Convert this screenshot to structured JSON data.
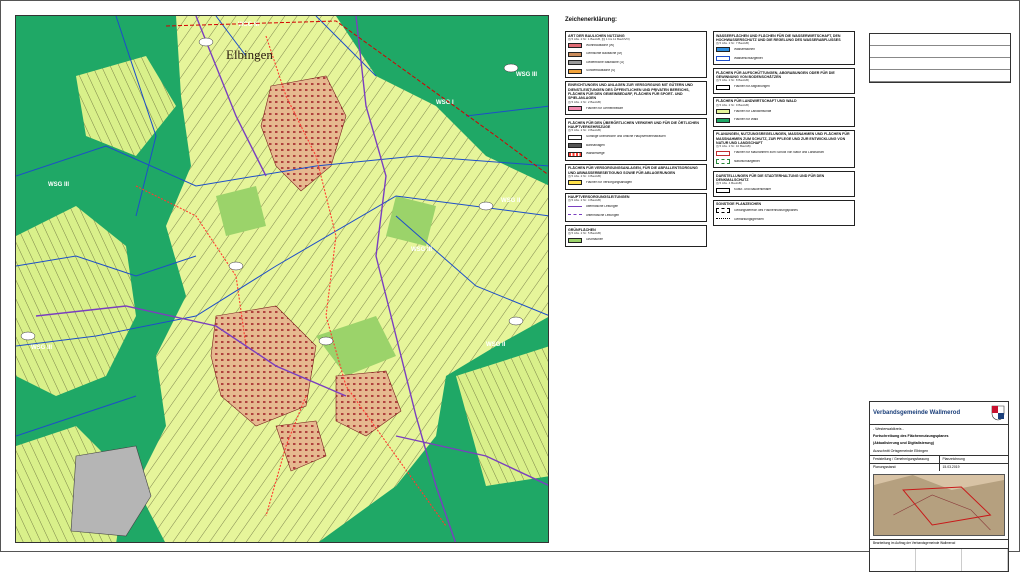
{
  "legend": {
    "heading": "Zeichenerklärung:",
    "column_a": [
      {
        "title": "ART DER BAULICHEN NUTZUNG",
        "ref": "(§ 5 Abs. 2 Nr. 1 BauGB, §§ 1 bis 11 BauNVO)",
        "rows": [
          {
            "label": "Wohnbaufläche (W)",
            "color": "#e06c75"
          },
          {
            "label": "Gemischte Baufläche (M)",
            "color": "#c98b5a"
          },
          {
            "label": "Gewerbliche Baufläche (G)",
            "color": "#9a9a9a"
          },
          {
            "label": "Sonderbaufläche (S)",
            "color": "#f2a23a"
          }
        ]
      },
      {
        "title": "EINRICHTUNGEN UND ANLAGEN ZUR VERSORGUNG MIT GÜTERN UND DIENSTLEISTUNGEN DES ÖFFENTLICHEN UND PRIVATEN BEREICHS, FLÄCHEN FÜR DEN GEMEINBEDARF, FLÄCHEN FÜR SPORT- UND SPIELANLAGEN",
        "ref": "(§ 5 Abs. 2 Nr. 2 BauGB)",
        "rows": [
          {
            "label": "Flächen für Gemeinbedarf",
            "color": "#f28bb0"
          }
        ]
      },
      {
        "title": "FLÄCHEN FÜR DEN ÜBERÖRTLICHEN VERKEHR UND FÜR DIE ÖRTLICHEN HAUPTVERKEHRSZÜGE",
        "ref": "(§ 5 Abs. 2 Nr. 3 BauGB)",
        "rows": [
          {
            "label": "Sonstige überörtliche und örtliche Hauptverkehrsstraßen",
            "color": "#ffffff"
          },
          {
            "label": "Bahnanlagen",
            "color": "#555555"
          },
          {
            "label": "Wanderwege",
            "color": "#ff3b30"
          }
        ]
      },
      {
        "title": "FLÄCHEN FÜR VERSORGUNGSANLAGEN, FÜR DIE ABFALLENTSORGUNG UND ABWASSERBESEITIGUNG SOWIE FÜR ABLAGERUNGEN",
        "ref": "(§ 5 Abs. 2 Nr. 4 BauGB)",
        "rows": [
          {
            "label": "Flächen für Versorgungsanlagen",
            "color": "#ffe14a"
          }
        ]
      },
      {
        "title": "HAUPTVERSORGUNGSLEITUNGEN",
        "ref": "(§ 5 Abs. 2 Nr. 4 BauGB)",
        "rows": [
          {
            "label": "oberirdische Leitungen",
            "color": "#7a3fbf"
          },
          {
            "label": "unterirdische Leitungen",
            "color": "#7a3fbf"
          }
        ]
      },
      {
        "title": "GRÜNFLÄCHEN",
        "ref": "(§ 5 Abs. 2 Nr. 5 BauGB)",
        "rows": [
          {
            "label": "Grünflächen",
            "color": "#9bd36a"
          }
        ]
      }
    ],
    "column_b": [
      {
        "title": "WASSERFLÄCHEN UND FLÄCHEN FÜR DIE WASSERWIRTSCHAFT, DEN HOCHWASSERSCHUTZ UND DIE REGELUNG DES WASSERABFLUSSES",
        "ref": "(§ 5 Abs. 2 Nr. 7 BauGB)",
        "rows": [
          {
            "label": "Wasserflächen",
            "color": "#2e8fe0"
          },
          {
            "label": "Wasserschutzgebiet",
            "color": "#ffffff"
          }
        ]
      },
      {
        "title": "FLÄCHEN FÜR AUFSCHÜTTUNGEN, ABGRABUNGEN ODER FÜR DIE GEWINNUNG VON BODENSCHÄTZEN",
        "ref": "(§ 5 Abs. 2 Nr. 8 BauGB)",
        "rows": [
          {
            "label": "Flächen für Abgrabungen",
            "color": "#ffffff"
          }
        ]
      },
      {
        "title": "FLÄCHEN FÜR LANDWIRTSCHAFT UND WALD",
        "ref": "(§ 5 Abs. 2 Nr. 9 BauGB)",
        "rows": [
          {
            "label": "Flächen für Landwirtschaft",
            "color": "#e6f59a"
          },
          {
            "label": "Flächen für Wald",
            "color": "#1fa866"
          }
        ]
      },
      {
        "title": "PLANUNGEN, NUTZUNGSREGELUNGEN, MASSNAHMEN UND FLÄCHEN FÜR MASSNAHMEN ZUM SCHUTZ, ZUR PFLEGE UND ZUR ENTWICKLUNG VON NATUR UND LANDSCHAFT",
        "ref": "(§ 5 Abs. 2 Nr. 10 BauGB)",
        "rows": [
          {
            "label": "Flächen für Maßnahmen zum Schutz von Natur und Landschaft",
            "color": "#ffffff"
          },
          {
            "label": "Naturschutzgebiet",
            "color": "#ffffff"
          }
        ]
      },
      {
        "title": "DARSTELLUNGEN FÜR DIE STADTERHALTUNG UND FÜR DEN DENKMALSCHUTZ",
        "ref": "(§ 5 Abs. 4 BauGB)",
        "rows": [
          {
            "label": "Kultur- und Baudenkmäler",
            "color": "#ffffff"
          }
        ]
      },
      {
        "title": "SONSTIGE PLANZEICHEN",
        "ref": "",
        "rows": [
          {
            "label": "Geltungsbereich des Flächennutzungsplanes",
            "color": "#ffffff"
          },
          {
            "label": "Gemarkungsgrenzen",
            "color": "#ffffff"
          }
        ]
      }
    ]
  },
  "map": {
    "place_label": "Elbingen",
    "zone_labels": [
      "WSG III",
      "WSG III",
      "WSG III",
      "WSG II",
      "WSG II",
      "WSG III",
      "WSG I",
      "WSG III"
    ]
  },
  "titleblock": {
    "municipality": "Verbandsgemeinde Wallmerod",
    "district": "- Westerwaldkreis -",
    "project_line1": "Fortschreibung des Flächennutzungsplanes",
    "project_line2": "(Aktualisierung und Digitalisierung)",
    "sheet": "Ausschnitt Ortsgemeinde Elbingen",
    "phase": "Feststellung / Genehmigungsfassung",
    "date_label": "Planungsstand:",
    "date_value": "15.03.2019",
    "scale": "Planzeichnung",
    "office": "Bearbeitung im Auftrag der Verbandsgemeinde Wallmerod"
  },
  "colors": {
    "forest": "#1fa866",
    "agriculture": "#e6f59a",
    "residential": "#e06c75",
    "mixed": "#c98b5a",
    "water": "#2e8fe0",
    "zone_line": "#1d4ec9",
    "power_line": "#7a3fbf",
    "hiking": "#ff3b30",
    "industrial": "#9a9a9a"
  }
}
